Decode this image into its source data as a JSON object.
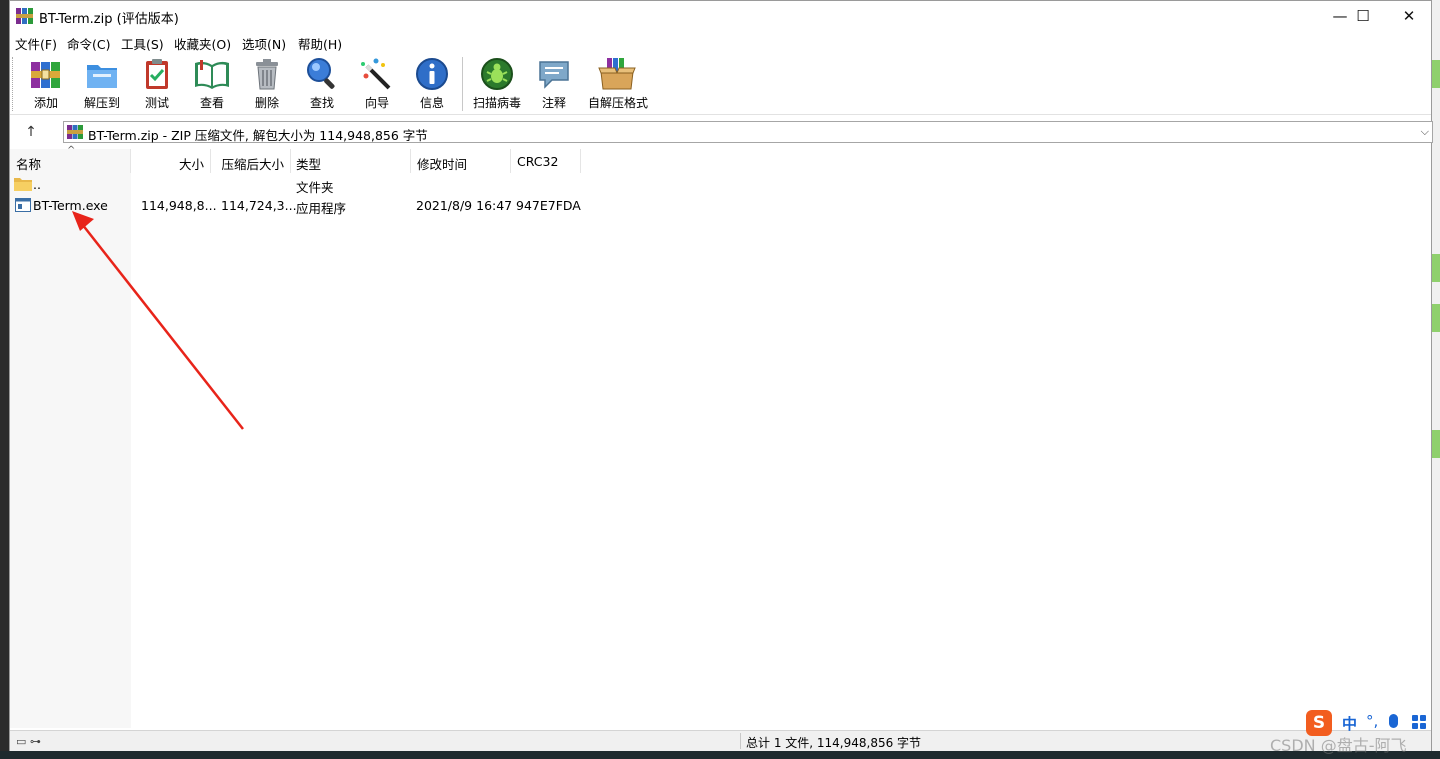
{
  "window": {
    "title": "BT-Term.zip (评估版本)",
    "controls": {
      "minimize": "—",
      "maximize": "☐",
      "close": "✕"
    }
  },
  "menu": [
    "文件(F)",
    "命令(C)",
    "工具(S)",
    "收藏夹(O)",
    "选项(N)",
    "帮助(H)"
  ],
  "toolbar": {
    "add": "添加",
    "extract_to": "解压到",
    "test": "测试",
    "view": "查看",
    "delete": "删除",
    "find": "查找",
    "wizard": "向导",
    "info": "信息",
    "virus_scan": "扫描病毒",
    "comment": "注释",
    "sfx": "自解压格式"
  },
  "address": {
    "text": "BT-Term.zip - ZIP 压缩文件, 解包大小为 114,948,856 字节"
  },
  "columns": {
    "name": "名称",
    "size": "大小",
    "packed": "压缩后大小",
    "type": "类型",
    "modified": "修改时间",
    "crc": "CRC32"
  },
  "files": [
    {
      "name": "..",
      "size": "",
      "packed": "",
      "type": "文件夹",
      "modified": "",
      "crc": "",
      "icon": "folder-icon"
    },
    {
      "name": "BT-Term.exe",
      "size": "114,948,8...",
      "packed": "114,724,3...",
      "type": "应用程序",
      "modified": "2021/8/9 16:47",
      "crc": "947E7FDA",
      "icon": "exe-icon"
    }
  ],
  "status": {
    "summary": "总计 1 文件, 114,948,856 字节",
    "icons": "▭ ⊶"
  },
  "ime": {
    "logo": "S",
    "lang": "中",
    "punct": "°,"
  },
  "watermark": "CSDN @盘古-阿飞",
  "colors": {
    "annotation_arrow": "#e8241a",
    "ime_blue": "#1a66d4",
    "ime_orange": "#f25d1f"
  }
}
